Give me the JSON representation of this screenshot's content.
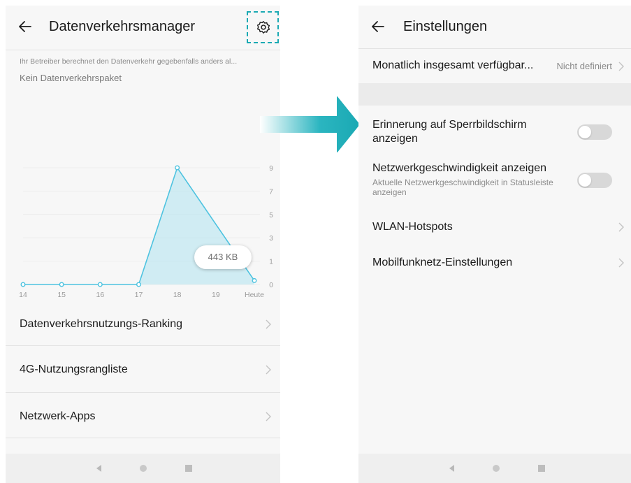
{
  "left_screen": {
    "title": "Datenverkehrsmanager",
    "back_icon": "back-arrow-icon",
    "settings_icon": "gear-icon",
    "highlight_color": "#1aa9b3",
    "operator_note": "Ihr Betreiber berechnet den Datenverkehr gegebenfalls anders al...",
    "package_status": "Kein Datenverkehrspaket",
    "tooltip": "443 KB",
    "menu": [
      {
        "label": "Datenverkehrsnutzungs-Ranking"
      },
      {
        "label": "4G-Nutzungsrangliste"
      },
      {
        "label": "Netzwerk-Apps"
      }
    ]
  },
  "chart_data": {
    "type": "area",
    "x": [
      "14",
      "15",
      "16",
      "17",
      "18",
      "19",
      "Heute"
    ],
    "values": [
      0,
      0,
      0,
      0,
      9,
      null,
      0.3
    ],
    "y_ticks": [
      "9",
      "7",
      "5",
      "3",
      "1",
      "0"
    ],
    "ylim": [
      0,
      9
    ],
    "grid": true,
    "color": "#4ec3e0"
  },
  "right_screen": {
    "title": "Einstellungen",
    "back_icon": "back-arrow-icon",
    "monthly": {
      "label": "Monatlich insgesamt verfügbar...",
      "value": "Nicht definiert"
    },
    "lockscreen": {
      "label": "Erinnerung auf Sperrbildschirm anzeigen",
      "enabled": false
    },
    "network_speed": {
      "label": "Netzwerkgeschwindigkeit anzeigen",
      "sub": "Aktuelle Netzwerkgeschwindigkeit in Statusleiste anzeigen",
      "enabled": false
    },
    "wlan": {
      "label": "WLAN-Hotspots"
    },
    "mobile": {
      "label": "Mobilfunknetz-Einstellungen"
    }
  },
  "nav_icons": [
    "nav-back-icon",
    "nav-home-icon",
    "nav-recent-icon"
  ]
}
